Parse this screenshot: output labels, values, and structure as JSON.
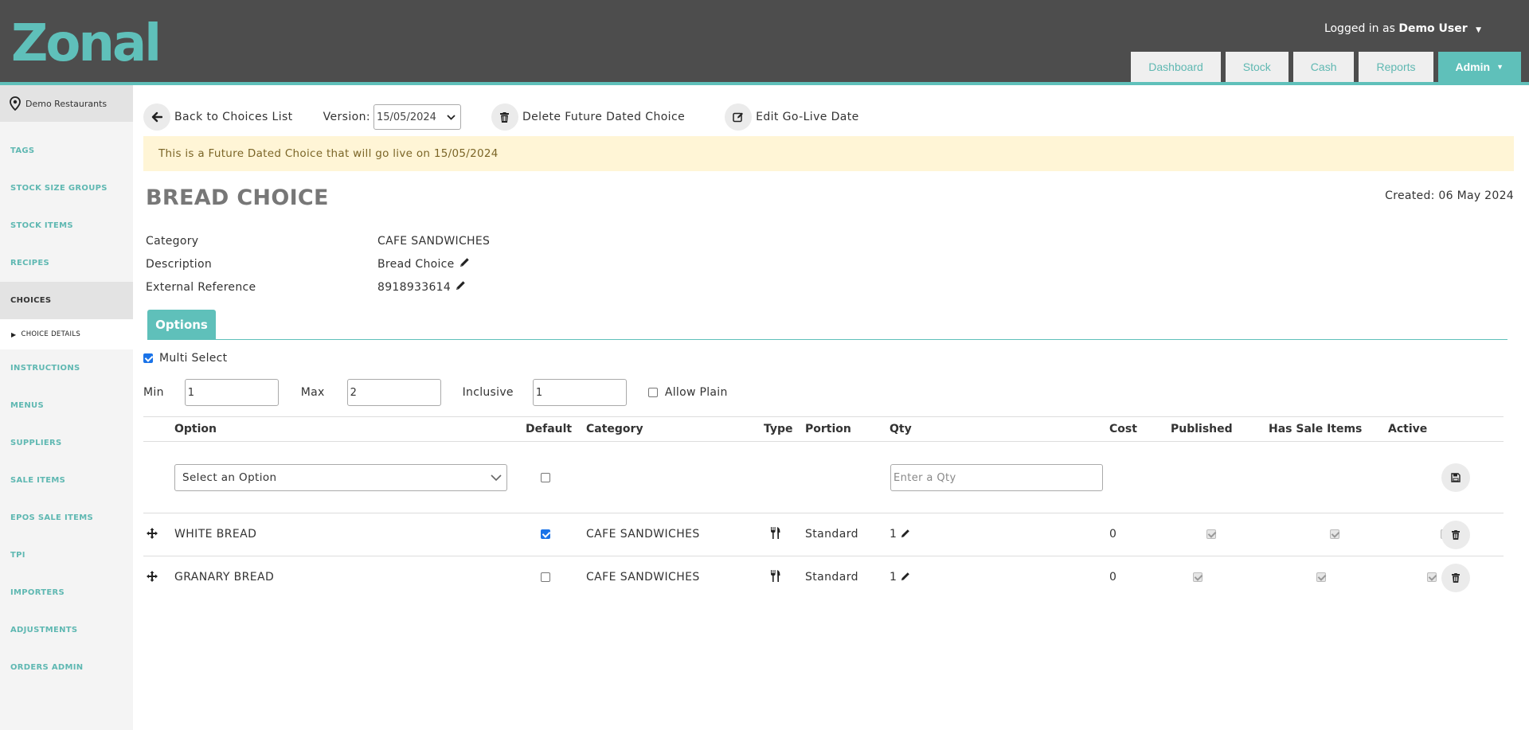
{
  "brand": {
    "logo_text": "Zonal",
    "accent_color": "#5fc0ba",
    "header_color": "#4d4d4d"
  },
  "header": {
    "logged_in_prefix": "Logged in as",
    "user_name": "Demo User",
    "nav": [
      {
        "label": "Dashboard"
      },
      {
        "label": "Stock"
      },
      {
        "label": "Cash"
      },
      {
        "label": "Reports"
      },
      {
        "label": "Admin"
      }
    ]
  },
  "sidebar": {
    "site": "Demo Restaurants",
    "items": [
      {
        "label": "TAGS"
      },
      {
        "label": "STOCK SIZE GROUPS"
      },
      {
        "label": "STOCK ITEMS"
      },
      {
        "label": "RECIPES"
      },
      {
        "label": "CHOICES"
      },
      {
        "label": "INSTRUCTIONS"
      },
      {
        "label": "MENUS"
      },
      {
        "label": "SUPPLIERS"
      },
      {
        "label": "SALE ITEMS"
      },
      {
        "label": "EPOS SALE ITEMS"
      },
      {
        "label": "TPI"
      },
      {
        "label": "IMPORTERS"
      },
      {
        "label": "ADJUSTMENTS"
      },
      {
        "label": "ORDERS ADMIN"
      }
    ],
    "sub_item": "CHOICE DETAILS"
  },
  "toolbar": {
    "back_label": "Back to Choices List",
    "version_label": "Version:",
    "version_value": "15/05/2024",
    "delete_label": "Delete Future Dated Choice",
    "edit_label": "Edit Go-Live Date"
  },
  "alert": "This is a Future Dated Choice that will go live on 15/05/2024",
  "choice": {
    "title": "BREAD CHOICE",
    "created": "Created: 06 May 2024",
    "fields": [
      {
        "key": "Category",
        "value": "CAFE SANDWICHES"
      },
      {
        "key": "Description",
        "value": "Bread Choice"
      },
      {
        "key": "External Reference",
        "value": "8918933614"
      }
    ]
  },
  "tabs": [
    {
      "label": "Options"
    }
  ],
  "options": {
    "multi_select_label": "Multi Select",
    "min_label": "Min",
    "min_value": "1",
    "max_label": "Max",
    "max_value": "2",
    "inclusive_label": "Inclusive",
    "inclusive_value": "1",
    "allow_plain_label": "Allow Plain"
  },
  "table": {
    "headers": {
      "option": "Option",
      "default": "Default",
      "category": "Category",
      "type": "Type",
      "portion": "Portion",
      "qty": "Qty",
      "cost": "Cost",
      "published": "Published",
      "has_sale_items": "Has Sale Items",
      "active": "Active"
    },
    "new_row": {
      "select_placeholder": "Select an Option",
      "qty_placeholder": "Enter a Qty"
    },
    "rows": [
      {
        "option": "WHITE BREAD",
        "default": true,
        "category": "CAFE SANDWICHES",
        "portion": "Standard",
        "qty": "1",
        "cost": "0"
      },
      {
        "option": "GRANARY BREAD",
        "default": false,
        "category": "CAFE SANDWICHES",
        "portion": "Standard",
        "qty": "1",
        "cost": "0"
      }
    ]
  }
}
